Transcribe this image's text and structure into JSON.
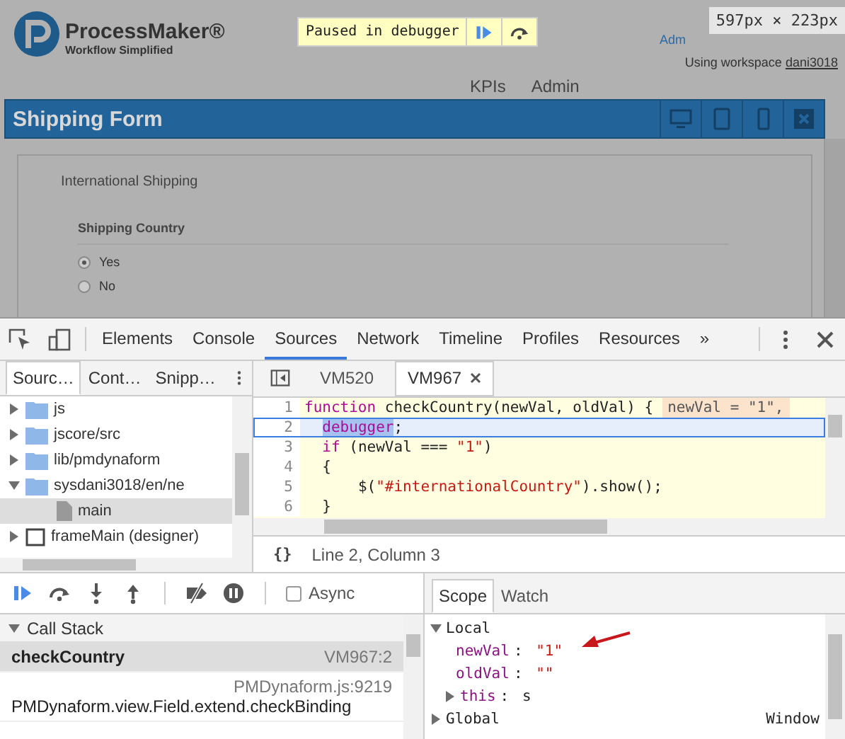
{
  "page": {
    "logo": {
      "name": "ProcessMaker®",
      "tagline": "Workflow Simplified"
    },
    "debugger_banner": {
      "text": "Paused in debugger"
    },
    "user_link": "Adm",
    "workspace": {
      "label": "Using workspace",
      "name": "dani3018"
    },
    "nav": [
      {
        "label": "KPIs"
      },
      {
        "label": "Admin"
      }
    ],
    "form": {
      "title": "Shipping Form",
      "section": "International Shipping",
      "field_label": "Shipping Country",
      "options": [
        {
          "label": "Yes",
          "selected": true
        },
        {
          "label": "No",
          "selected": false
        }
      ]
    }
  },
  "dimension_badge": "597px × 223px",
  "devtools": {
    "tabs": [
      {
        "label": "Elements",
        "selected": false
      },
      {
        "label": "Console",
        "selected": false
      },
      {
        "label": "Sources",
        "selected": true
      },
      {
        "label": "Network",
        "selected": false
      },
      {
        "label": "Timeline",
        "selected": false
      },
      {
        "label": "Profiles",
        "selected": false
      },
      {
        "label": "Resources",
        "selected": false
      }
    ],
    "more": "»",
    "navigator": {
      "tabs": [
        {
          "label": "Sourc…",
          "selected": true
        },
        {
          "label": "Cont…",
          "selected": false
        },
        {
          "label": "Snipp…",
          "selected": false
        }
      ],
      "tree": [
        {
          "label": "js",
          "kind": "folder",
          "expanded": false,
          "selected": false
        },
        {
          "label": "jscore/src",
          "kind": "folder",
          "expanded": false,
          "selected": false
        },
        {
          "label": "lib/pmdynaform",
          "kind": "folder",
          "expanded": false,
          "selected": false
        },
        {
          "label": "sysdani3018/en/ne",
          "kind": "folder",
          "expanded": true,
          "selected": false,
          "children": [
            {
              "label": "main",
              "kind": "file",
              "selected": true
            }
          ]
        },
        {
          "label": "frameMain (designer)",
          "kind": "frame",
          "expanded": false,
          "selected": false
        }
      ]
    },
    "editor": {
      "tabs": [
        {
          "label": "VM520",
          "selected": false,
          "closable": false
        },
        {
          "label": "VM967",
          "selected": true,
          "closable": true
        }
      ],
      "lines": [
        {
          "number": "1",
          "current": false,
          "tokens": [
            {
              "text": "function",
              "kind": "keyword"
            },
            {
              "text": " checkCountry(newVal, oldVal) {",
              "kind": "plain"
            }
          ],
          "inline_value": "newVal = \"1\","
        },
        {
          "number": "2",
          "current": true,
          "tokens": [
            {
              "text": "  debugger",
              "kind": "selection"
            },
            {
              "text": ";",
              "kind": "plain"
            }
          ]
        },
        {
          "number": "3",
          "current": false,
          "tokens": [
            {
              "text": "  if",
              "kind": "keyword"
            },
            {
              "text": " (newVal === ",
              "kind": "plain"
            },
            {
              "text": "\"1\"",
              "kind": "string"
            },
            {
              "text": ")",
              "kind": "plain"
            }
          ]
        },
        {
          "number": "4",
          "current": false,
          "tokens": [
            {
              "text": "  {",
              "kind": "plain"
            }
          ]
        },
        {
          "number": "5",
          "current": false,
          "tokens": [
            {
              "text": "      $(",
              "kind": "plain"
            },
            {
              "text": "\"#internationalCountry\"",
              "kind": "string"
            },
            {
              "text": ").show();",
              "kind": "plain"
            }
          ]
        },
        {
          "number": "6",
          "current": false,
          "tokens": [
            {
              "text": "  }",
              "kind": "plain"
            }
          ]
        }
      ],
      "format_button": "{}",
      "cursor_position": "Line 2, Column 3"
    },
    "debugger": {
      "async": {
        "label": "Async",
        "checked": false
      },
      "call_stack": {
        "title": "Call Stack",
        "expanded": true,
        "frames": [
          {
            "kind": "inline",
            "name": "checkCountry",
            "location": "VM967:2",
            "selected": true
          },
          {
            "kind": "wrapped",
            "name": "PMDynaform.view.Field.extend.checkBinding",
            "location": "PMDynaform.js:9219",
            "selected": false
          }
        ]
      }
    },
    "sidebar_tabs": [
      {
        "label": "Scope",
        "selected": true
      },
      {
        "label": "Watch",
        "selected": false
      }
    ],
    "scope": [
      {
        "label": "Local",
        "expanded": true,
        "children": [
          {
            "name": "newVal",
            "separator": ":",
            "value": "\"1\"",
            "kind": "string"
          },
          {
            "name": "oldVal",
            "separator": ":",
            "value": "\"\"",
            "kind": "string"
          },
          {
            "name": "this",
            "separator": ":",
            "value": "s",
            "kind": "object",
            "expanded": false
          }
        ]
      },
      {
        "label": "Global",
        "value": "Window",
        "expanded": false
      }
    ]
  }
}
